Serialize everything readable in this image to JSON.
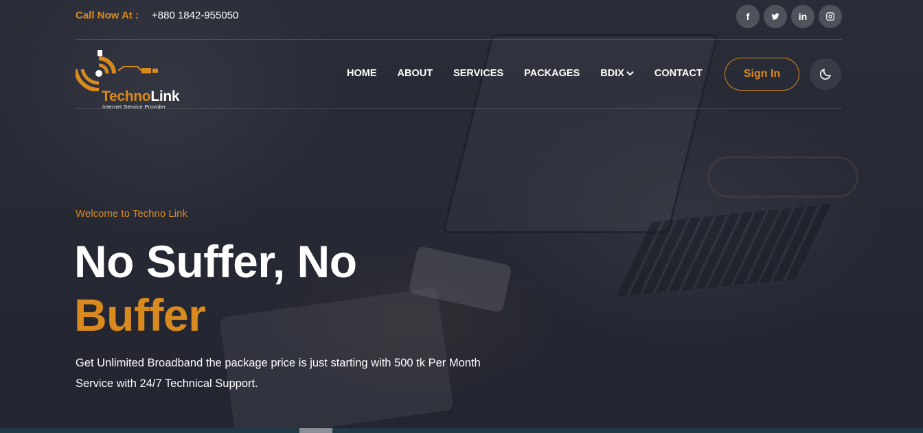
{
  "topbar": {
    "call_label": "Call Now At :",
    "phone": "+880 1842-955050",
    "socials": [
      {
        "icon": "facebook-icon",
        "glyph": "f"
      },
      {
        "icon": "twitter-icon",
        "glyph": ""
      },
      {
        "icon": "linkedin-icon",
        "glyph": "in"
      },
      {
        "icon": "instagram-icon",
        "glyph": ""
      }
    ]
  },
  "brand": {
    "name_part1": "Techno",
    "name_part2": "Link",
    "tagline": "Internet Service Provider"
  },
  "nav": {
    "items": [
      {
        "label": "HOME"
      },
      {
        "label": "ABOUT"
      },
      {
        "label": "SERVICES"
      },
      {
        "label": "PACKAGES"
      },
      {
        "label": "BDIX",
        "dropdown": true
      },
      {
        "label": "CONTACT"
      }
    ],
    "signin_label": "Sign In",
    "theme_icon": "moon-icon"
  },
  "hero": {
    "welcome": "Welcome to Techno Link",
    "headline": "No Suffer, No",
    "headline_accent": "Buffer",
    "description": "Get Unlimited Broadband the package price is just starting with 500 tk Per Month Service with 24/7 Technical Support."
  },
  "colors": {
    "accent": "#d98a1e",
    "text": "#ffffff",
    "overlay": "#1e202d"
  }
}
